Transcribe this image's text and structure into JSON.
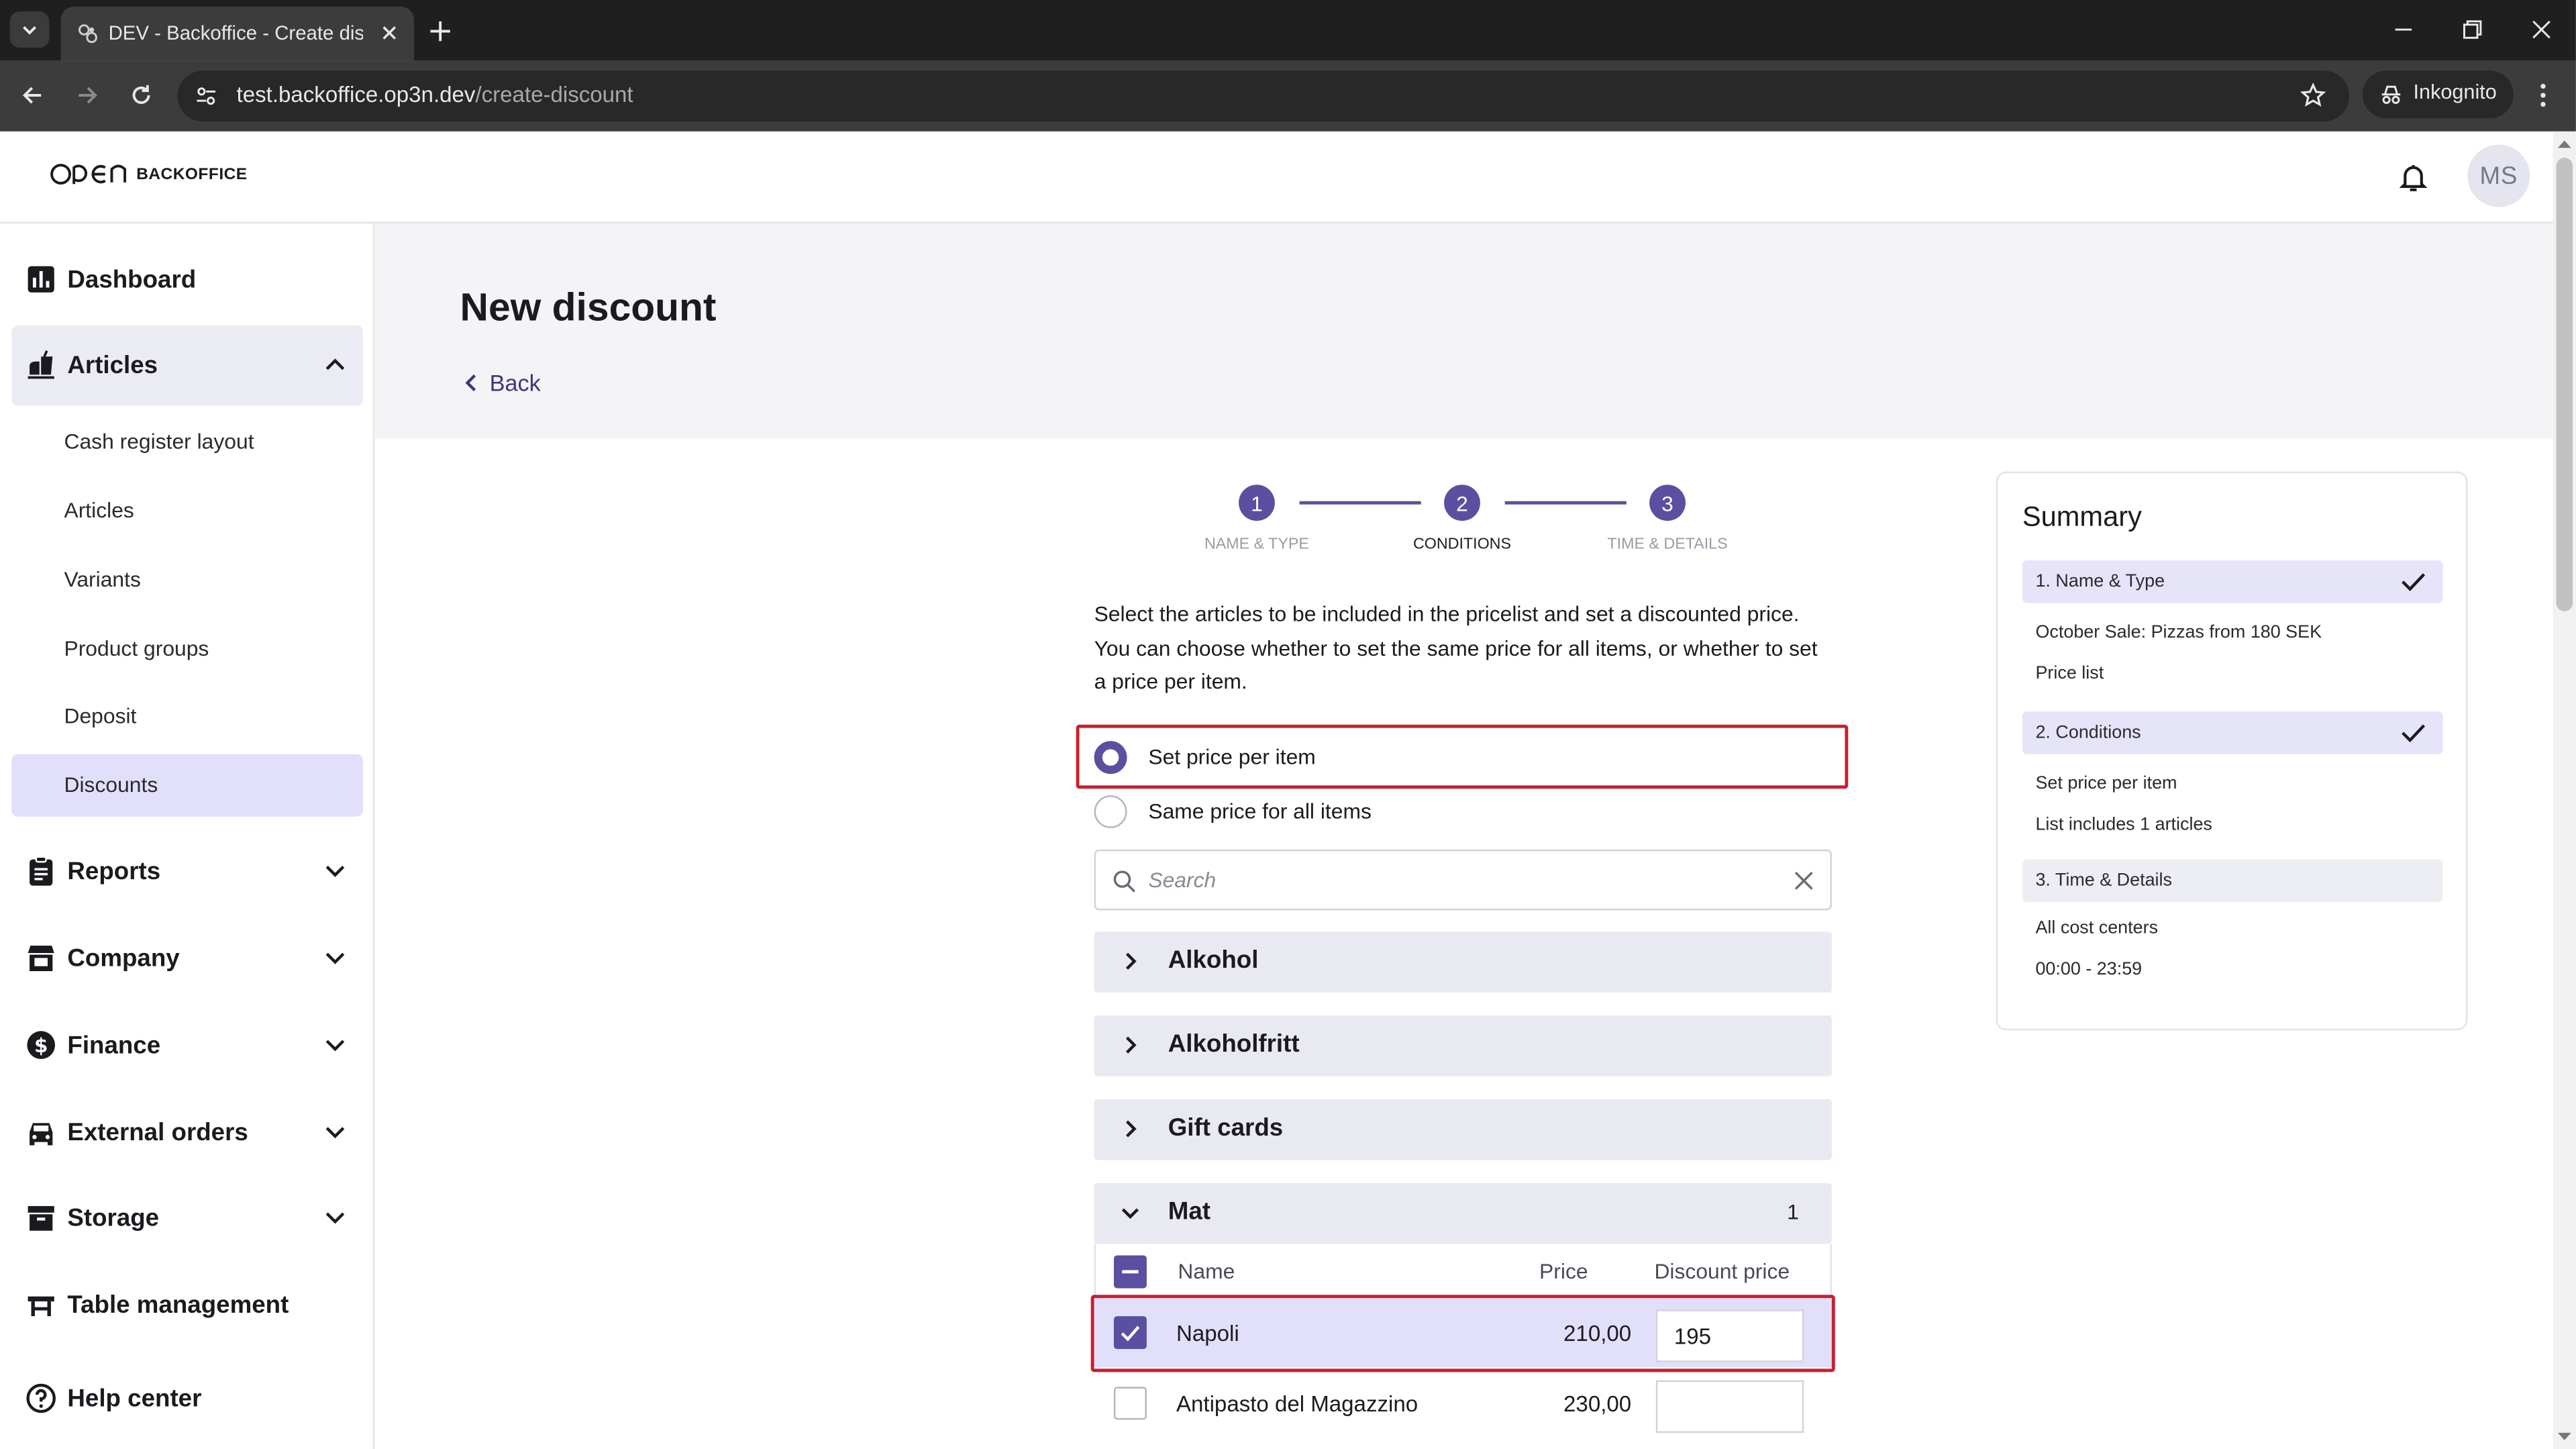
{
  "browser": {
    "tab_title": "DEV - Backoffice - Create discount",
    "url_host": "test.backoffice.op3n.dev",
    "url_path": "/create-discount",
    "incognito_label": "Inkognito"
  },
  "header": {
    "logo_text": "BACKOFFICE",
    "avatar_initials": "MS"
  },
  "sidebar": {
    "dashboard": "Dashboard",
    "articles": "Articles",
    "articles_sub": [
      "Cash register layout",
      "Articles",
      "Variants",
      "Product groups",
      "Deposit",
      "Discounts"
    ],
    "reports": "Reports",
    "company": "Company",
    "finance": "Finance",
    "external_orders": "External orders",
    "storage": "Storage",
    "table_management": "Table management",
    "help_center": "Help center"
  },
  "page": {
    "title": "New discount",
    "back_label": "Back"
  },
  "stepper": {
    "steps": [
      {
        "number": "1",
        "label": "NAME & TYPE",
        "state": "done"
      },
      {
        "number": "2",
        "label": "CONDITIONS",
        "state": "active"
      },
      {
        "number": "3",
        "label": "TIME & DETAILS",
        "state": "upcoming"
      }
    ]
  },
  "conditions": {
    "intro": "Select the articles to be included in the pricelist and set a discounted price. You can choose whether to set the same price for all items, or whether to set a price per item.",
    "option_per_item": "Set price per item",
    "option_same_price": "Same price for all items",
    "selected_option": "Set price per item",
    "search_placeholder": "Search",
    "groups": [
      {
        "name": "Alkohol",
        "expanded": false
      },
      {
        "name": "Alkoholfritt",
        "expanded": false
      },
      {
        "name": "Gift cards",
        "expanded": false
      },
      {
        "name": "Mat",
        "expanded": true,
        "count": "1"
      }
    ],
    "table": {
      "col_name": "Name",
      "col_price": "Price",
      "col_discount": "Discount price",
      "rows": [
        {
          "name": "Napoli",
          "price": "210,00",
          "discount": "195",
          "checked": true
        },
        {
          "name": "Antipasto del Magazzino",
          "price": "230,00",
          "discount": "",
          "checked": false
        }
      ]
    }
  },
  "summary": {
    "title": "Summary",
    "sections": [
      {
        "label": "1. Name & Type",
        "done": true,
        "lines": [
          "October Sale: Pizzas from 180 SEK",
          "Price list"
        ]
      },
      {
        "label": "2. Conditions",
        "done": true,
        "lines": [
          "Set price per item",
          "List includes 1 articles"
        ]
      },
      {
        "label": "3. Time & Details",
        "done": false,
        "lines": [
          "All cost centers",
          "00:00 - 23:59"
        ]
      }
    ]
  },
  "colors": {
    "accent": "#5b4fa0",
    "highlight": "#c8202f",
    "selected_bg": "#e2dffb"
  }
}
